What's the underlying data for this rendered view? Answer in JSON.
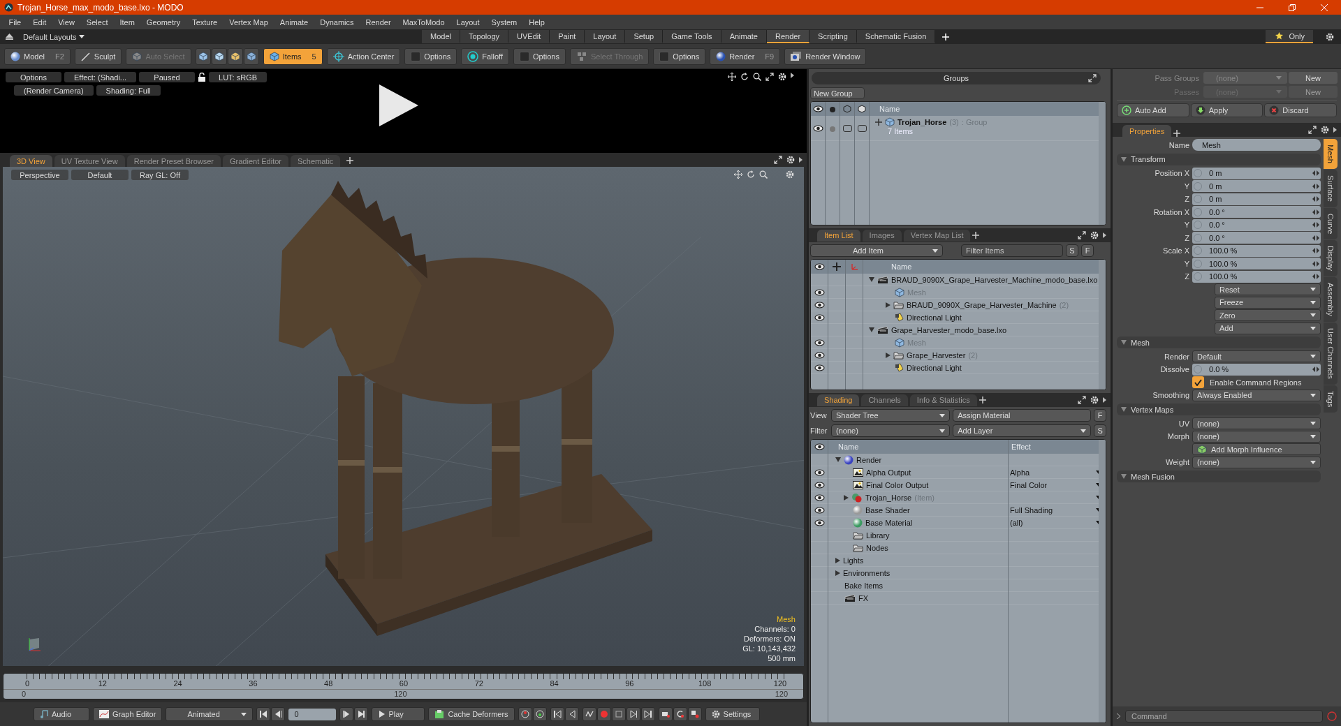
{
  "window": {
    "title": "Trojan_Horse_max_modo_base.lxo - MODO"
  },
  "menu": [
    "File",
    "Edit",
    "View",
    "Select",
    "Item",
    "Geometry",
    "Texture",
    "Vertex Map",
    "Animate",
    "Dynamics",
    "Render",
    "MaxToModo",
    "Layout",
    "System",
    "Help"
  ],
  "layout_bar": {
    "preset": "Default Layouts",
    "tabs": [
      {
        "label": "Model",
        "selected": false
      },
      {
        "label": "Topology",
        "selected": false
      },
      {
        "label": "UVEdit",
        "selected": false
      },
      {
        "label": "Paint",
        "selected": false
      },
      {
        "label": "Layout",
        "selected": false
      },
      {
        "label": "Setup",
        "selected": false
      },
      {
        "label": "Game Tools",
        "selected": false
      },
      {
        "label": "Animate",
        "selected": false
      },
      {
        "label": "Render",
        "selected": true
      },
      {
        "label": "Scripting",
        "selected": false
      },
      {
        "label": "Schematic Fusion",
        "selected": false
      }
    ],
    "only": {
      "label": "Only",
      "on": true
    }
  },
  "toolbar": [
    {
      "kind": "model",
      "label": "Model",
      "shortcut": "F2",
      "selected": false,
      "disabled": false
    },
    {
      "kind": "sculpt",
      "label": "Sculpt",
      "selected": false,
      "disabled": false
    },
    {
      "kind": "auto-select",
      "label": "Auto Select",
      "selected": false,
      "disabled": true
    },
    {
      "kind": "select-icons"
    },
    {
      "kind": "items",
      "label": "Items",
      "shortcut": "5",
      "selected": true,
      "disabled": false
    },
    {
      "kind": "action-center",
      "label": "Action Center",
      "selected": false,
      "disabled": false
    },
    {
      "kind": "option",
      "label": "Options",
      "checked": false
    },
    {
      "kind": "falloff",
      "label": "Falloff",
      "selected": false,
      "disabled": false
    },
    {
      "kind": "option",
      "label": "Options",
      "checked": false
    },
    {
      "kind": "select-through",
      "label": "Select Through",
      "selected": false,
      "disabled": true
    },
    {
      "kind": "option",
      "label": "Options",
      "checked": false
    },
    {
      "kind": "render",
      "label": "Render",
      "shortcut": "F9",
      "selected": false,
      "disabled": false
    },
    {
      "kind": "render-window",
      "label": "Render Window",
      "selected": false,
      "disabled": false
    }
  ],
  "render_preview": {
    "row_1": [
      "Options",
      "Effect: (Shadi...",
      "Paused",
      "LUT: sRGB"
    ],
    "row_2": [
      "(Render Camera)",
      "Shading: Full"
    ]
  },
  "viewport": {
    "tabs": [
      {
        "label": "3D View",
        "selected": true
      },
      {
        "label": "UV Texture View",
        "selected": false
      },
      {
        "label": "Render Preset Browser",
        "selected": false
      },
      {
        "label": "Gradient Editor",
        "selected": false
      },
      {
        "label": "Schematic",
        "selected": false
      }
    ],
    "buttons": [
      "Perspective",
      "Default",
      "Ray GL: Off"
    ],
    "info_title": "Mesh",
    "info_lines": [
      "Channels: 0",
      "Deformers: ON",
      "GL: 10,143,432",
      "500 mm"
    ]
  },
  "timeline": {
    "ticks": [
      "0",
      "12",
      "24",
      "36",
      "48",
      "60",
      "72",
      "84",
      "96",
      "108",
      "120"
    ],
    "range": [
      "0",
      "120",
      "120"
    ]
  },
  "transport": [
    {
      "kind": "audio",
      "label": "Audio"
    },
    {
      "kind": "graph-editor",
      "label": "Graph Editor"
    },
    {
      "kind": "dropdown",
      "label": "Animated"
    },
    {
      "kind": "skip-back"
    },
    {
      "kind": "frame",
      "value": "0"
    },
    {
      "kind": "skip-forward"
    },
    {
      "kind": "play",
      "label": "Play"
    },
    {
      "kind": "cache",
      "label": "Cache Deformers"
    },
    {
      "kind": "key-tools"
    },
    {
      "kind": "key-nav"
    },
    {
      "kind": "record-tools"
    },
    {
      "kind": "misc-tools"
    },
    {
      "kind": "settings",
      "label": "Settings"
    }
  ],
  "groups": {
    "title": "Groups",
    "new_group": "New Group",
    "column": "Name",
    "rows": [
      {
        "name": "Trojan_Horse",
        "count": "(3)",
        "type": ": Group",
        "items": "7 Items",
        "expanded": false
      }
    ]
  },
  "item_list": {
    "tabs": [
      {
        "label": "Item List",
        "selected": true
      },
      {
        "label": "Images",
        "selected": false
      },
      {
        "label": "Vertex Map List",
        "selected": false
      }
    ],
    "add_item": "Add Item",
    "filter_placeholder": "Filter Items",
    "s": "S",
    "f": "F",
    "column": "Name",
    "rows": [
      {
        "name": "BRAUD_9090X_Grape_Harvester_Machine_modo_base.lxo",
        "kind": "scene",
        "expanded": true,
        "children": [
          {
            "name": "Mesh",
            "kind": "mesh",
            "visible": true,
            "disabled": true
          },
          {
            "name": "BRAUD_9090X_Grape_Harvester_Machine",
            "count": "(2)",
            "kind": "folder",
            "expanded": false,
            "visible": true,
            "disabled": false
          },
          {
            "name": "Directional Light",
            "kind": "light",
            "visible": true,
            "disabled": false
          }
        ]
      },
      {
        "name": "Grape_Harvester_modo_base.lxo",
        "kind": "scene",
        "expanded": true,
        "children": [
          {
            "name": "Mesh",
            "kind": "mesh",
            "visible": true,
            "disabled": true
          },
          {
            "name": "Grape_Harvester",
            "count": "(2)",
            "kind": "folder",
            "expanded": false,
            "visible": true,
            "disabled": false
          },
          {
            "name": "Directional Light",
            "kind": "light",
            "visible": true,
            "disabled": false
          }
        ]
      }
    ]
  },
  "shading": {
    "tabs": [
      {
        "label": "Shading",
        "selected": true
      },
      {
        "label": "Channels",
        "selected": false
      },
      {
        "label": "Info & Statistics",
        "selected": false
      }
    ],
    "view_label": "View",
    "view": "Shader Tree",
    "assign": "Assign Material",
    "f": "F",
    "filter_label": "Filter",
    "filter": "(none)",
    "add_layer": "Add Layer",
    "s": "S",
    "columns": [
      "Name",
      "Effect"
    ],
    "rows": [
      {
        "name": "Render",
        "kind": "render",
        "expanded": true,
        "visible": false,
        "children": [
          {
            "name": "Alpha Output",
            "kind": "output",
            "visible": true,
            "effect": "Alpha"
          },
          {
            "name": "Final Color Output",
            "kind": "output",
            "visible": true,
            "effect": "Final Color"
          },
          {
            "name": "Trojan_Horse",
            "note": "(Item)",
            "kind": "material-group",
            "expanded": false,
            "visible": true
          },
          {
            "name": "Base Shader",
            "kind": "shader",
            "visible": true,
            "effect": "Full Shading"
          },
          {
            "name": "Base Material",
            "kind": "material",
            "visible": true,
            "effect": "(all)"
          },
          {
            "name": "Library",
            "kind": "folder",
            "visible": false
          },
          {
            "name": "Nodes",
            "kind": "folder",
            "visible": false
          }
        ]
      },
      {
        "name": "Lights",
        "kind": "none",
        "expanded": false,
        "visible": false
      },
      {
        "name": "Environments",
        "kind": "none",
        "expanded": false,
        "visible": false
      },
      {
        "name": "Bake Items",
        "kind": "none",
        "visible": false
      },
      {
        "name": "FX",
        "kind": "fx",
        "visible": false
      }
    ]
  },
  "passes": {
    "pass_groups": {
      "label": "Pass Groups",
      "value": "(none)",
      "button": "New",
      "disabled": false
    },
    "passes": {
      "label": "Passes",
      "value": "(none)",
      "button": "New",
      "disabled": true
    },
    "actions": [
      {
        "kind": "auto-add",
        "label": "Auto Add"
      },
      {
        "kind": "apply",
        "label": "Apply"
      },
      {
        "kind": "discard",
        "label": "Discard"
      }
    ]
  },
  "properties": {
    "tab": "Properties",
    "name_label": "Name",
    "name_value": "Mesh",
    "sections": [
      {
        "title": "Transform",
        "expanded": true,
        "rows": [
          {
            "kind": "number",
            "label": "Position X",
            "value": "0 m"
          },
          {
            "kind": "number",
            "label": "Y",
            "value": "0 m"
          },
          {
            "kind": "number",
            "label": "Z",
            "value": "0 m"
          },
          {
            "kind": "number",
            "label": "Rotation X",
            "value": "0.0 °"
          },
          {
            "kind": "number",
            "label": "Y",
            "value": "0.0 °"
          },
          {
            "kind": "number",
            "label": "Z",
            "value": "0.0 °"
          },
          {
            "kind": "number",
            "label": "Scale X",
            "value": "100.0 %"
          },
          {
            "kind": "number",
            "label": "Y",
            "value": "100.0 %"
          },
          {
            "kind": "number",
            "label": "Z",
            "value": "100.0 %"
          },
          {
            "kind": "menu",
            "value": "Reset"
          },
          {
            "kind": "menu",
            "value": "Freeze"
          },
          {
            "kind": "menu",
            "value": "Zero"
          },
          {
            "kind": "menu",
            "value": "Add"
          }
        ]
      },
      {
        "title": "Mesh",
        "expanded": true,
        "rows": [
          {
            "kind": "dropdown",
            "label": "Render",
            "value": "Default"
          },
          {
            "kind": "number",
            "label": "Dissolve",
            "value": "0.0 %"
          },
          {
            "kind": "checkbox",
            "label": "Enable Command Regions",
            "checked": true
          },
          {
            "kind": "dropdown",
            "label": "Smoothing",
            "value": "Always Enabled"
          }
        ]
      },
      {
        "title": "Vertex Maps",
        "expanded": true,
        "rows": [
          {
            "kind": "dropdown",
            "label": "UV",
            "value": "(none)"
          },
          {
            "kind": "dropdown",
            "label": "Morph",
            "value": "(none)"
          },
          {
            "kind": "button",
            "label": "Add Morph Influence"
          },
          {
            "kind": "dropdown",
            "label": "Weight",
            "value": "(none)"
          }
        ]
      },
      {
        "title": "Mesh Fusion",
        "expanded": true
      }
    ],
    "side_tabs": [
      {
        "label": "Mesh",
        "selected": true
      },
      {
        "label": "Surface",
        "selected": false
      },
      {
        "label": "Curve",
        "selected": false
      },
      {
        "label": "Display",
        "selected": false
      },
      {
        "label": "Assembly",
        "selected": false
      },
      {
        "label": "User Channels",
        "selected": false
      },
      {
        "label": "Tags",
        "selected": false
      }
    ]
  },
  "command": {
    "placeholder": "Command"
  }
}
